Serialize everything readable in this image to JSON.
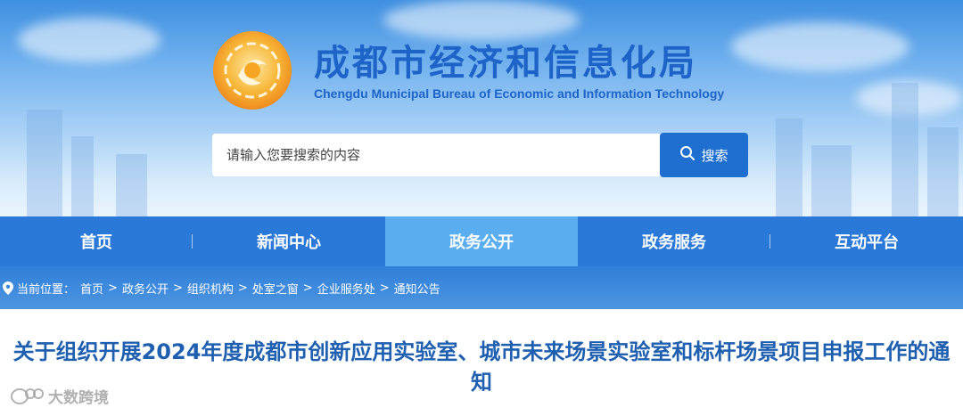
{
  "header": {
    "site_title": "成都市经济和信息化局",
    "site_subtitle": "Chengdu Municipal Bureau of Economic and Information Technology",
    "logo_icon": "phoenix-emblem-icon",
    "brand_color": "#1e64c8"
  },
  "search": {
    "placeholder": "请输入您要搜索的内容",
    "button_label": "搜索",
    "button_icon": "search-icon"
  },
  "nav": {
    "items": [
      {
        "label": "首页"
      },
      {
        "label": "新闻中心"
      },
      {
        "label": "政务公开",
        "active": true
      },
      {
        "label": "政务服务"
      },
      {
        "label": "互动平台"
      }
    ],
    "bar_color": "#2a78d8",
    "active_color": "#5aaef0"
  },
  "breadcrumb": {
    "icon": "location-pin-icon",
    "prefix": "当前位置：",
    "separator": ">",
    "items": [
      "首页",
      "政务公开",
      "组织机构",
      "处室之窗",
      "企业服务处",
      "通知公告"
    ]
  },
  "article": {
    "title": "关于组织开展2024年度成都市创新应用实验室、城市未来场景实验室和标杆场景项目申报工作的通知",
    "title_color": "#1e5fb0"
  },
  "watermark": {
    "icon": "wechat-logo-icon",
    "text": "大数跨境"
  }
}
